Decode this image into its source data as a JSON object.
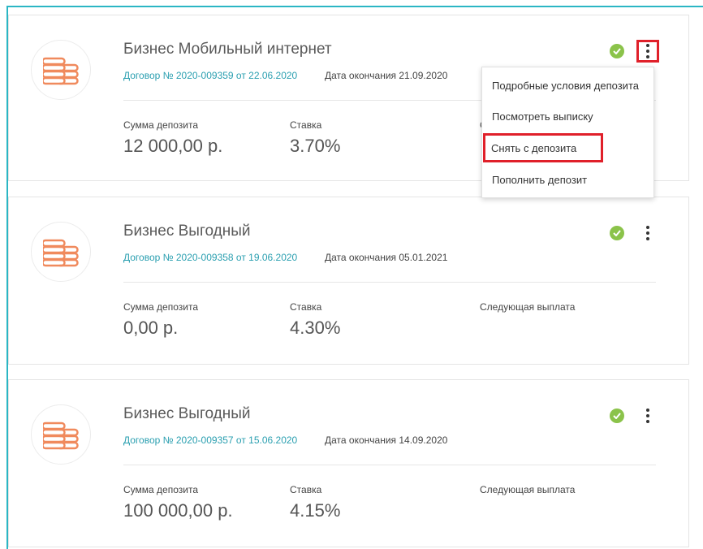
{
  "colors": {
    "accent": "#2a9fb0",
    "icon": "#f08a5d",
    "status_ok": "#8bc34a",
    "highlight": "#e0202a"
  },
  "deposits": [
    {
      "title": "Бизнес Мобильный интернет",
      "contract": "Договор № 2020-009359 от 22.06.2020",
      "end_date": "Дата окончания 21.09.2020",
      "sum_label": "Сумма депозита",
      "sum_value": "12 000,00 р.",
      "rate_label": "Ставка",
      "rate_value": "3.70%",
      "status_icon": "check-circle-icon",
      "menu_icon": "more-vertical-icon"
    },
    {
      "title": "Бизнес Выгодный",
      "contract": "Договор № 2020-009358 от 19.06.2020",
      "end_date": "Дата окончания 05.01.2021",
      "sum_label": "Сумма депозита",
      "sum_value": "0,00 р.",
      "rate_label": "Ставка",
      "rate_value": "4.30%",
      "next_label": "Следующая выплата",
      "status_icon": "check-circle-icon",
      "menu_icon": "more-vertical-icon"
    },
    {
      "title": "Бизнес Выгодный",
      "contract": "Договор № 2020-009357 от 15.06.2020",
      "end_date": "Дата окончания 14.09.2020",
      "sum_label": "Сумма депозита",
      "sum_value": "100 000,00 р.",
      "rate_label": "Ставка",
      "rate_value": "4.15%",
      "next_label": "Следующая выплата",
      "status_icon": "check-circle-icon",
      "menu_icon": "more-vertical-icon"
    }
  ],
  "dropdown_menu": {
    "items": [
      "Подробные условия депозита",
      "Посмотреть выписку",
      "Снять с депозита",
      "Пополнить депозит"
    ],
    "first_card_partial_label": "С"
  }
}
